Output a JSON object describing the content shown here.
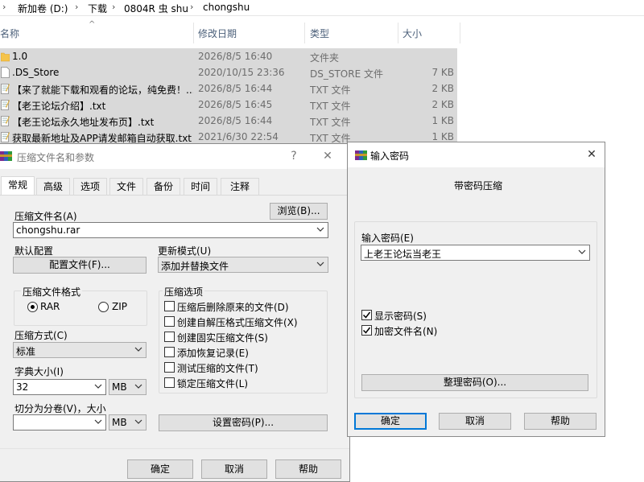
{
  "explorer": {
    "breadcrumb": [
      "新加卷 (D:)",
      "下载",
      "0804R 虫 shu",
      "chongshu"
    ],
    "columns": {
      "name": "名称",
      "modified": "修改日期",
      "type": "类型",
      "size": "大小"
    },
    "files": [
      {
        "name": "1.0",
        "modified": "2026/8/5 16:40",
        "type": "文件夹",
        "size": "",
        "icon": "folder-icon"
      },
      {
        "name": ".DS_Store",
        "modified": "2020/10/15 23:36",
        "type": "DS_STORE 文件",
        "size": "7 KB",
        "icon": "file-icon"
      },
      {
        "name": "【来了就能下载和观看的论坛，纯免费！...",
        "modified": "2026/8/5 16:44",
        "type": "TXT 文件",
        "size": "2 KB",
        "icon": "text-file-icon"
      },
      {
        "name": "【老王论坛介绍】.txt",
        "modified": "2026/8/5 16:45",
        "type": "TXT 文件",
        "size": "2 KB",
        "icon": "text-file-icon"
      },
      {
        "name": "【老王论坛永久地址发布页】.txt",
        "modified": "2026/8/5 16:44",
        "type": "TXT 文件",
        "size": "1 KB",
        "icon": "text-file-icon"
      },
      {
        "name": "获取最新地址及APP请发邮箱自动获取.txt",
        "modified": "2021/6/30 22:54",
        "type": "TXT 文件",
        "size": "1 KB",
        "icon": "text-file-icon"
      }
    ]
  },
  "archive_dialog": {
    "title": "压缩文件名和参数",
    "help_btn": "?",
    "close_btn": "✕",
    "tabs": [
      "常规",
      "高级",
      "选项",
      "文件",
      "备份",
      "时间",
      "注释"
    ],
    "archive_name_label": "压缩文件名(A)",
    "browse_btn": "浏览(B)...",
    "archive_name_value": "chongshu.rar",
    "default_profile_label": "默认配置",
    "profile_btn": "配置文件(F)...",
    "update_mode_label": "更新模式(U)",
    "update_mode_value": "添加并替换文件",
    "format_group": "压缩文件格式",
    "format_rar": "RAR",
    "format_zip": "ZIP",
    "options_group": "压缩选项",
    "options": [
      "压缩后删除原来的文件(D)",
      "创建自解压格式压缩文件(X)",
      "创建固实压缩文件(S)",
      "添加恢复记录(E)",
      "测试压缩的文件(T)",
      "锁定压缩文件(L)"
    ],
    "method_label": "压缩方式(C)",
    "method_value": "标准",
    "dict_label": "字典大小(I)",
    "dict_value": "32",
    "dict_unit": "MB",
    "split_label": "切分为分卷(V)，大小",
    "split_value": "",
    "split_unit": "MB",
    "set_password_btn": "设置密码(P)...",
    "ok_btn": "确定",
    "cancel_btn": "取消",
    "help_btn_bottom": "帮助"
  },
  "password_dialog": {
    "title": "输入密码",
    "close_btn": "✕",
    "heading": "带密码压缩",
    "password_label": "输入密码(E)",
    "password_value": "上老王论坛当老王",
    "show_password": "显示密码(S)",
    "show_password_checked": true,
    "encrypt_names": "加密文件名(N)",
    "encrypt_names_checked": true,
    "organize_btn": "整理密码(O)...",
    "ok_btn": "确定",
    "cancel_btn": "取消",
    "help_btn": "帮助"
  },
  "colors": {
    "row_selected": "#d9d9d9",
    "header_text": "#4c607a",
    "accent": "#0078d7",
    "dialog_bg": "#f0f0f0"
  }
}
